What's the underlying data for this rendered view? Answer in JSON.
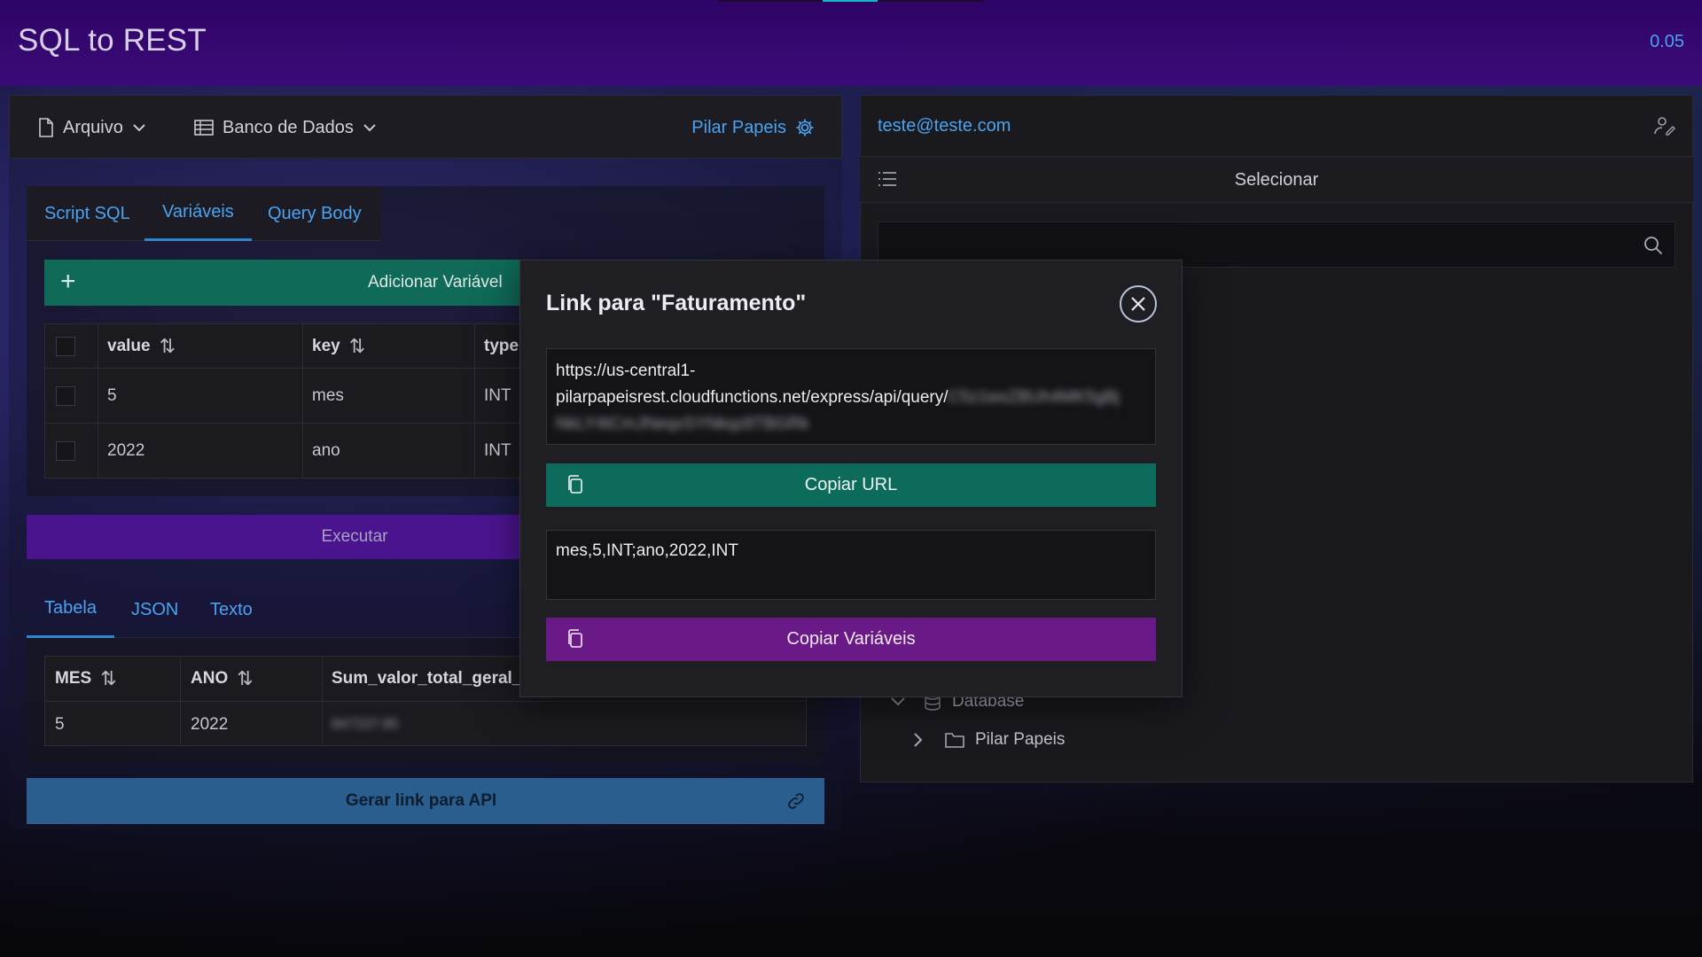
{
  "app": {
    "title": "SQL to REST",
    "version": "0.05"
  },
  "left_toolbar": {
    "file_menu": "Arquivo",
    "database_menu": "Banco de Dados",
    "user_link": "Pilar Papeis"
  },
  "editor_tabs": [
    "Script SQL",
    "Variáveis",
    "Query Body"
  ],
  "editor_active_tab": "Variáveis",
  "add_variable_label": "Adicionar Variável",
  "variables_table": {
    "headers": [
      "value",
      "key",
      "type"
    ],
    "rows": [
      {
        "value": "5",
        "key": "mes",
        "type": "INT"
      },
      {
        "value": "2022",
        "key": "ano",
        "type": "INT"
      }
    ]
  },
  "execute_label": "Executar",
  "result_tabs": [
    "Tabela",
    "JSON",
    "Texto"
  ],
  "result_active_tab": "Tabela",
  "result_table": {
    "headers": [
      "MES",
      "ANO",
      "Sum_valor_total_geral_p"
    ],
    "rows": [
      {
        "mes": "5",
        "ano": "2022",
        "sum": "847237.85"
      }
    ]
  },
  "generate_link_label": "Gerar link para API",
  "right_panel": {
    "email": "teste@teste.com",
    "select_label": "Selecionar",
    "search_placeholder": "",
    "tree": {
      "root": "Database",
      "child": "Pilar Papeis"
    }
  },
  "modal": {
    "title": "Link para \"Faturamento\"",
    "url_visible": "https://us-central1-pilarpapeisrest.cloudfunctions.net/express/api/query/",
    "url_line1": "https://us-central1-",
    "url_line2": "pilarpapeisrest.cloudfunctions.net/express/api/query/",
    "url_hidden_part1": "C5z1wxZBUh4MK5gBj",
    "url_hidden_part2": "NkLY4tCmJNeqxSYNkqz8TBGRk",
    "copy_url_label": "Copiar URL",
    "variables_text": "mes,5,INT;ano,2022,INT",
    "copy_variables_label": "Copiar Variáveis"
  },
  "colors": {
    "topbar": "#3b0a78",
    "accent_blue": "#4aa3f0",
    "teal_button": "#0c6b5b",
    "purple_button": "#6a1a86",
    "execute_button": "#4b148f",
    "generate_button": "#2a5e8e"
  }
}
